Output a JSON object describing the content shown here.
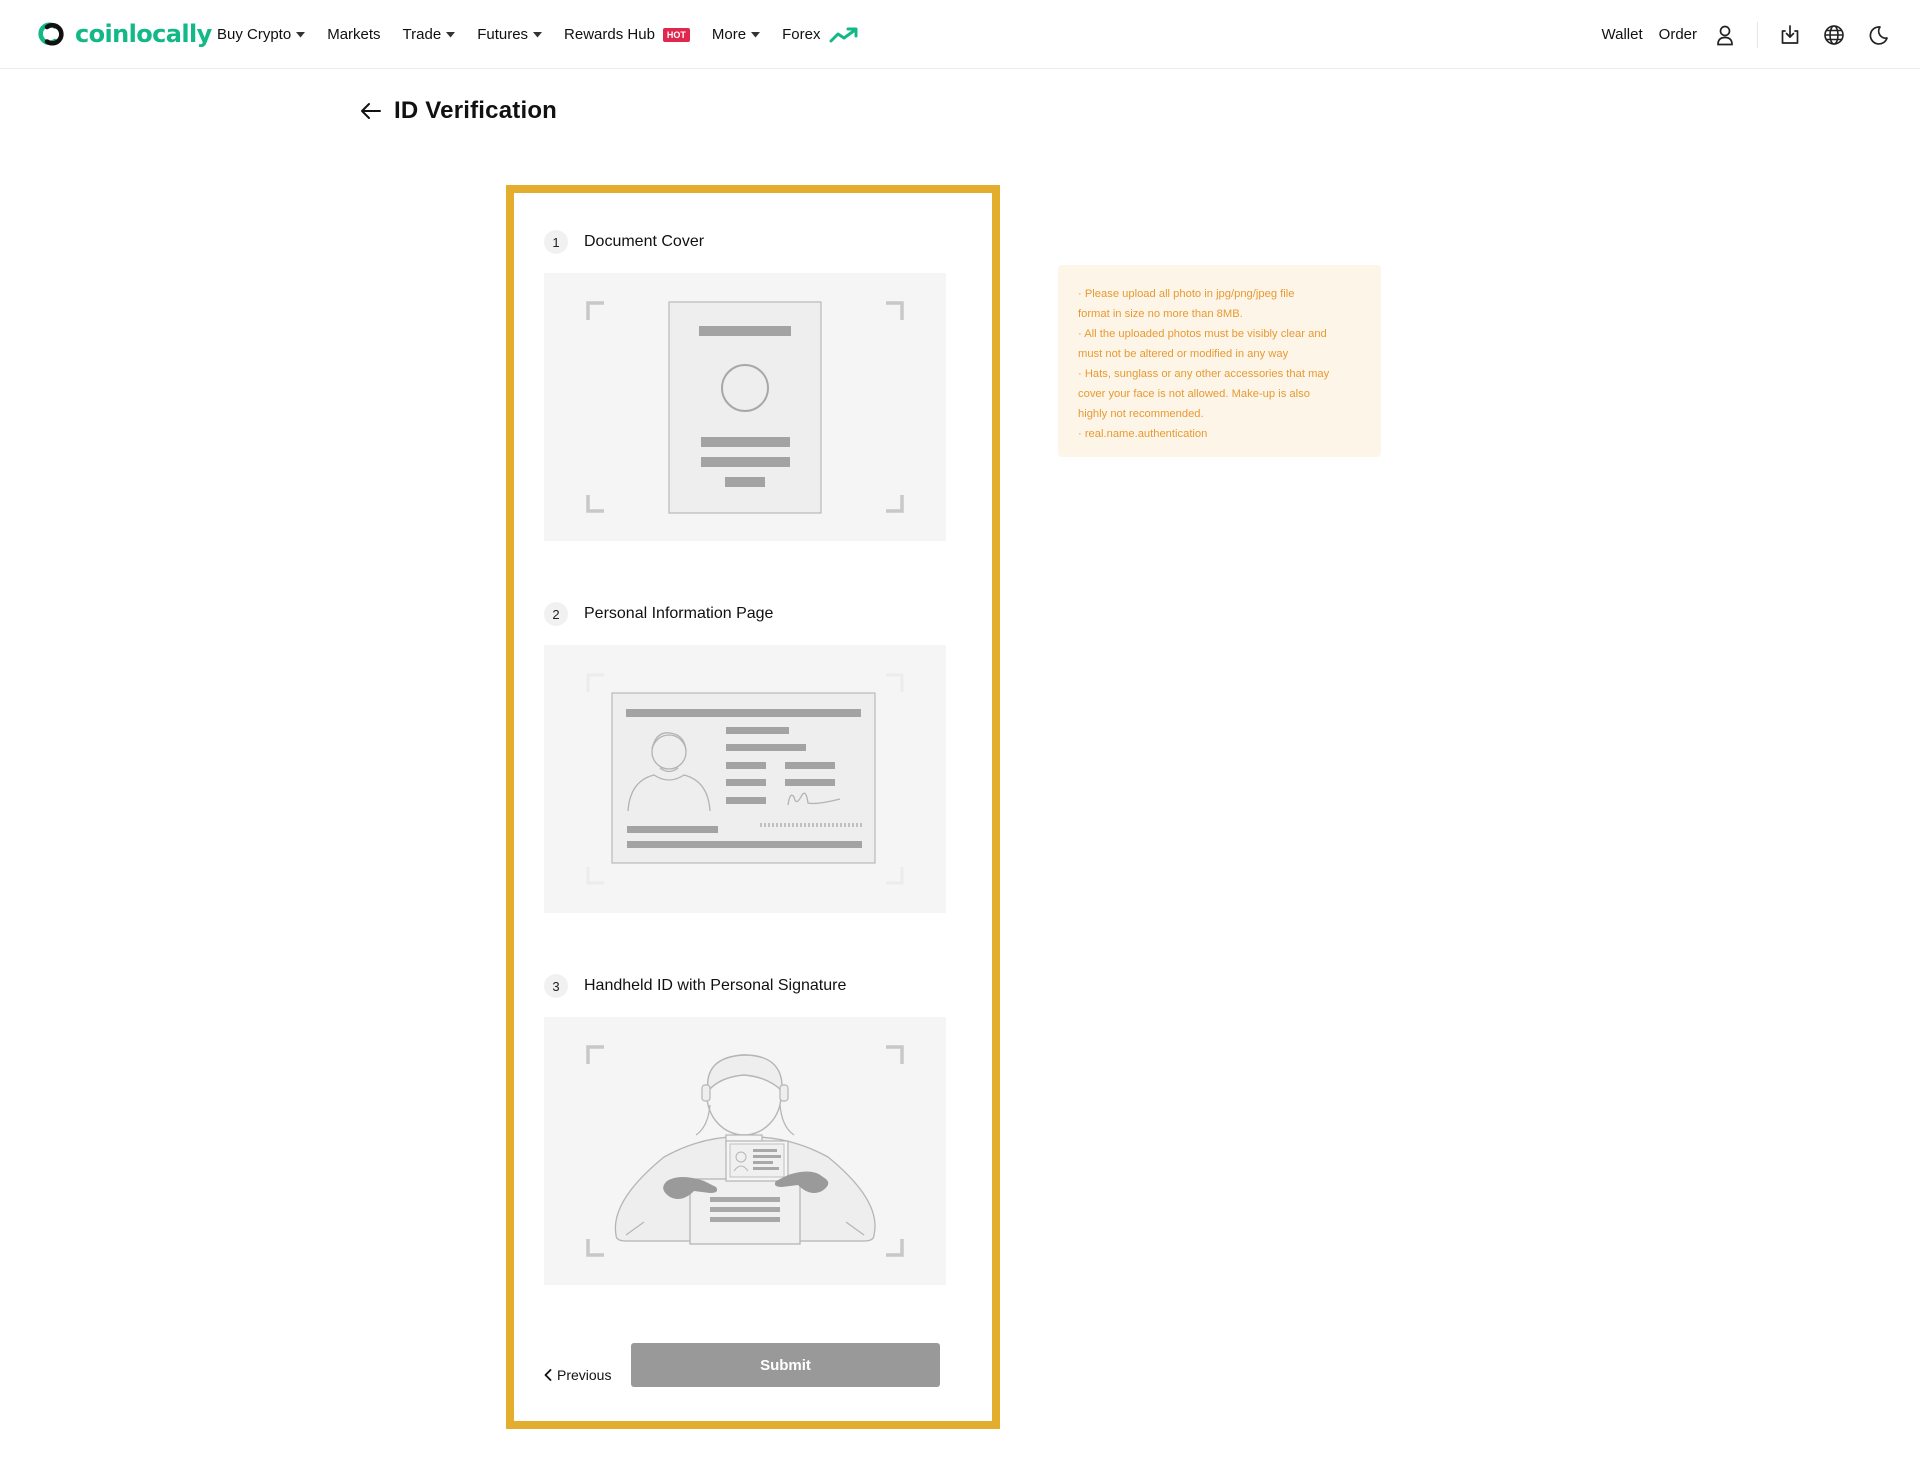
{
  "brand": {
    "name": "coinlocally",
    "color": "#12b886"
  },
  "nav": {
    "items": [
      {
        "label": "Buy Crypto",
        "caret": true
      },
      {
        "label": "Markets",
        "caret": false
      },
      {
        "label": "Trade",
        "caret": true
      },
      {
        "label": "Futures",
        "caret": true
      },
      {
        "label": "Rewards Hub",
        "badge": "HOT"
      },
      {
        "label": "More",
        "caret": true
      },
      {
        "label": "Forex",
        "icon": "trend-up-icon"
      }
    ],
    "right": {
      "wallet": "Wallet",
      "order": "Order",
      "icons": [
        "user-icon",
        "download-icon",
        "globe-icon",
        "moon-icon"
      ]
    }
  },
  "page": {
    "title": "ID Verification"
  },
  "steps": [
    {
      "number": "1",
      "title": "Document Cover",
      "illustration": "document-cover-illustration"
    },
    {
      "number": "2",
      "title": "Personal Information Page",
      "illustration": "id-info-page-illustration"
    },
    {
      "number": "3",
      "title": "Handheld ID with Personal Signature",
      "illustration": "handheld-id-illustration"
    }
  ],
  "actions": {
    "previous": "Previous",
    "submit": "Submit"
  },
  "notice": {
    "lines": [
      "· Please upload all photo in jpg/png/jpeg file",
      "format in size no more than 8MB.",
      "· All the uploaded photos must be visibly clear and",
      "must not be altered or modified in any way",
      "· Hats, sunglass or any other accessories that may",
      "cover your face is not allowed. Make-up is also",
      "highly not recommended.",
      "· real.name.authentication"
    ]
  },
  "colors": {
    "highlight_frame": "#e3ad2d",
    "notice_text": "#e79a33",
    "notice_bg": "#fdf5e8",
    "hot_badge": "#e0284f",
    "submit_disabled": "#999999"
  }
}
